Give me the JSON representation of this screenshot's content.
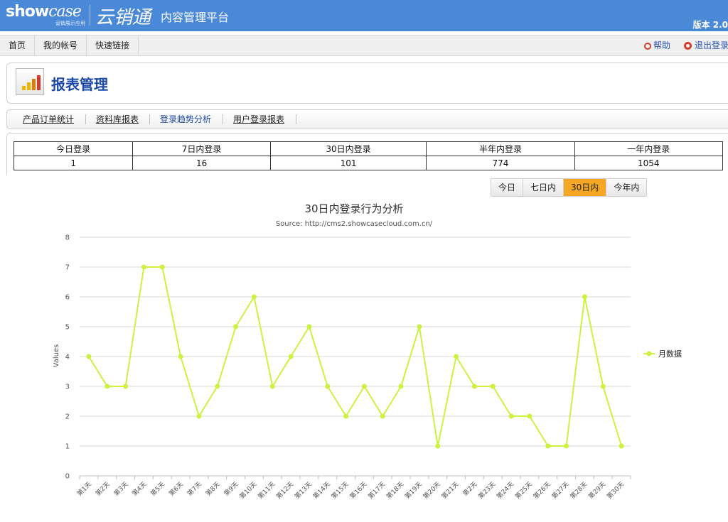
{
  "header": {
    "logo_text": "showcase",
    "logo_tm": "™",
    "logo_sub": "营销展示应用",
    "brand_cn": "云销通",
    "platform": "内容管理平台",
    "version": "版本 2.0"
  },
  "nav": {
    "items": [
      "首页",
      "我的帐号",
      "快速链接"
    ],
    "help": "帮助",
    "logout": "退出登录"
  },
  "page": {
    "title": "报表管理"
  },
  "tabs": [
    "产品订单统计",
    "资料库报表",
    "登录趋势分析",
    "用户登录报表"
  ],
  "active_tab": 2,
  "stats": {
    "headers": [
      "今日登录",
      "7日内登录",
      "30日内登录",
      "半年内登录",
      "一年内登录"
    ],
    "values": [
      "1",
      "16",
      "101",
      "774",
      "1054"
    ]
  },
  "range_buttons": [
    "今日",
    "七日内",
    "30日内",
    "今年内"
  ],
  "active_range": 2,
  "colors": {
    "header_bg": "#4a88d8",
    "active_range": "#f5a623",
    "series": "#ccf23f"
  },
  "chart_data": {
    "type": "line",
    "title": "30日内登录行为分析",
    "subtitle": "Source: http://cms2.showcasecloud.com.cn/",
    "ylabel": "Values",
    "xlabel": "",
    "ylim": [
      0,
      8
    ],
    "yticks": [
      "0",
      "1",
      "2",
      "3",
      "4",
      "5",
      "6",
      "7",
      "8"
    ],
    "categories": [
      "第1天",
      "第2天",
      "第3天",
      "第4天",
      "第5天",
      "第6天",
      "第7天",
      "第8天",
      "第9天",
      "第10天",
      "第11天",
      "第12天",
      "第13天",
      "第14天",
      "第15天",
      "第16天",
      "第17天",
      "第18天",
      "第19天",
      "第20天",
      "第21天",
      "第2天",
      "第23天",
      "第24天",
      "第25天",
      "第26天",
      "第27天",
      "第28天",
      "第29天",
      "第30天"
    ],
    "series": [
      {
        "name": "月数据",
        "values": [
          4,
          3,
          3,
          7,
          7,
          4,
          2,
          3,
          5,
          6,
          3,
          4,
          5,
          3,
          2,
          3,
          2,
          3,
          5,
          1,
          4,
          3,
          3,
          2,
          2,
          1,
          1,
          6,
          3,
          1
        ]
      }
    ],
    "grid": true,
    "legend_position": "right"
  }
}
